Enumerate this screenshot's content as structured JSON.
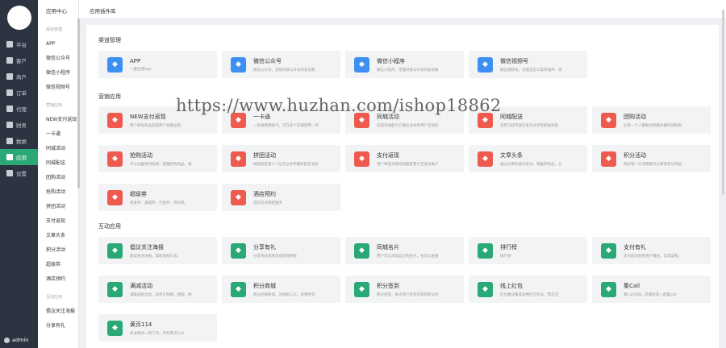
{
  "sidebar": {
    "items": [
      {
        "label": "平台",
        "icon": "monitor-icon",
        "active": false
      },
      {
        "label": "客户",
        "icon": "user-icon",
        "active": false
      },
      {
        "label": "商户",
        "icon": "users-icon",
        "active": false
      },
      {
        "label": "订单",
        "icon": "order-icon",
        "active": false
      },
      {
        "label": "代理",
        "icon": "agent-icon",
        "active": false
      },
      {
        "label": "财务",
        "icon": "finance-icon",
        "active": false
      },
      {
        "label": "数据",
        "icon": "data-icon",
        "active": false
      },
      {
        "label": "应用",
        "icon": "apps-icon",
        "active": true
      },
      {
        "label": "设置",
        "icon": "gear-icon",
        "active": false
      }
    ],
    "user": "admin",
    "accent": "#2aa876"
  },
  "subnav": {
    "title": "应用中心",
    "groups": [
      {
        "label": "渠道管理",
        "items": [
          "APP",
          "微信公众号",
          "微信小程序",
          "微信视频号"
        ]
      },
      {
        "label": "营销应用",
        "items": [
          "NEW支付返现",
          "一卡通",
          "同城活动",
          "同城配送",
          "团购活动",
          "抢购活动",
          "拼团活动",
          "支付返现",
          "文章头条",
          "积分活动",
          "超级券",
          "酒店预约"
        ]
      },
      {
        "label": "互动应用",
        "items": [
          "倡议关注海报",
          "分享有礼"
        ]
      }
    ]
  },
  "header": {
    "title": "应用插件库"
  },
  "watermark": "https://www.huzhan.com/ishop18862",
  "sections": [
    {
      "title": "渠道管理",
      "cards": [
        {
          "title": "APP",
          "desc": "一键生成App",
          "color": "#3d8ff3",
          "icon": "app-icon"
        },
        {
          "title": "微信公众号",
          "desc": "微信公众号，无缝对接公众号的会员数",
          "color": "#3d8ff3",
          "icon": "wechat-icon"
        },
        {
          "title": "微信小程序",
          "desc": "微信小程序，无缝对接公众号的会员数",
          "color": "#3d8ff3",
          "icon": "miniprogram-icon"
        },
        {
          "title": "微信视频号",
          "desc": "微信视频号，对接自定义菜单插件、视",
          "color": "#3d8ff3",
          "icon": "channels-icon"
        }
      ]
    },
    {
      "title": "营销应用",
      "cards": [
        {
          "title": "NEW支付返现",
          "desc": "用户每笔商品获取用户会额返现。",
          "color": "#ef5a4f",
          "icon": "money-bag-icon"
        },
        {
          "title": "一卡通",
          "desc": "一张通用储值卡，可在多个店铺使用，和",
          "color": "#ef5a4f",
          "icon": "heart-card-icon"
        },
        {
          "title": "同城活动",
          "desc": "同城活动能力方便企业采购用户活动店",
          "color": "#ef5a4f",
          "icon": "megaphone-icon"
        },
        {
          "title": "同城配送",
          "desc": "适用于超市就近发货派单等配送场景",
          "color": "#ef5a4f",
          "icon": "scooter-icon"
        },
        {
          "title": "团购活动",
          "desc": "让每一个人都能找到最优惠的团购商",
          "color": "#ef5a4f",
          "icon": "group-buy-icon"
        },
        {
          "title": "抢购活动",
          "desc": "可以设置限时抢购、限量抢购商品、限",
          "color": "#ef5a4f",
          "icon": "clock-icon"
        },
        {
          "title": "拼团活动",
          "desc": "拼团就是用户+社交分享传播的裂变活动",
          "color": "#ef5a4f",
          "icon": "team-icon"
        },
        {
          "title": "支付返现",
          "desc": "用户每笔消费返现额度累计至会员账户",
          "color": "#ef5a4f",
          "icon": "cashback-icon"
        },
        {
          "title": "文章头条",
          "desc": "通过文章的展示形式，来推荐商品，从",
          "color": "#ef5a4f",
          "icon": "article-icon"
        },
        {
          "title": "积分活动",
          "desc": "购买每一次消费都可以获得积分奖励",
          "color": "#ef5a4f",
          "icon": "points-icon"
        },
        {
          "title": "超级券",
          "desc": "现金券、满减券、代金券、折扣券。",
          "color": "#ef5a4f",
          "icon": "coupon-icon"
        },
        {
          "title": "酒店预约",
          "desc": "酒店房间预定服务",
          "color": "#ef5a4f",
          "icon": "hotel-icon"
        }
      ]
    },
    {
      "title": "互动应用",
      "cards": [
        {
          "title": "倡议关注海报",
          "desc": "倡议关注海报，帮助涨粉引流。",
          "color": "#2aa876",
          "icon": "heart-icon"
        },
        {
          "title": "分享有礼",
          "desc": "分享商品或者活动获得佣金",
          "color": "#2aa876",
          "icon": "share-icon"
        },
        {
          "title": "同城名片",
          "desc": "用户可以添加自己的名片，也可以查看",
          "color": "#2aa876",
          "icon": "card-icon"
        },
        {
          "title": "排行榜",
          "desc": "排行榜",
          "color": "#2aa876",
          "icon": "trophy-icon"
        },
        {
          "title": "支付有礼",
          "desc": "支付成功后给用户赠送，实现复购。",
          "color": "#2aa876",
          "icon": "gift-icon"
        },
        {
          "title": "满减活动",
          "desc": "满额减免活动，适用于购物、团购、拼",
          "color": "#2aa876",
          "icon": "tag-icon"
        },
        {
          "title": "积分商城",
          "desc": "积分兑换商城，对接第三方、优惠券等",
          "color": "#2aa876",
          "icon": "shop-icon"
        },
        {
          "title": "积分签到",
          "desc": "积分签到，每天用户签到可获得积分奖",
          "color": "#2aa876",
          "icon": "checkin-icon"
        },
        {
          "title": "线上红包",
          "desc": "红包模块集成多种红包玩法，营造活",
          "color": "#2aa876",
          "icon": "redpacket-icon"
        },
        {
          "title": "集Call",
          "desc": "集Call活动，获赠好友一起集call",
          "color": "#2aa876",
          "icon": "call-icon"
        },
        {
          "title": "黄页114",
          "desc": "商业服务一目了然，尽在黄页114",
          "color": "#2aa876",
          "icon": "yellowpage-icon"
        }
      ]
    }
  ]
}
